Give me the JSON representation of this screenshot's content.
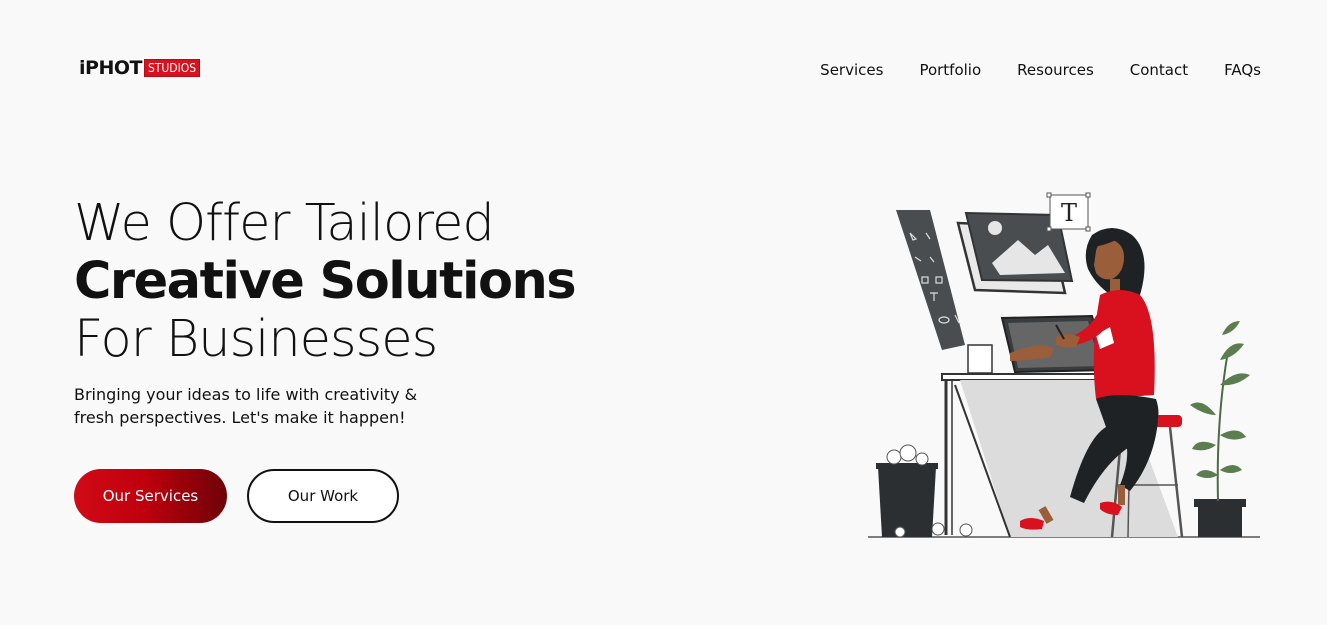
{
  "brand": {
    "name": "iPHOT",
    "tag": "STUDIOS",
    "accent": "#d9101e"
  },
  "nav": {
    "items": [
      {
        "label": "Services"
      },
      {
        "label": "Portfolio"
      },
      {
        "label": "Resources"
      },
      {
        "label": "Contact"
      },
      {
        "label": "FAQs"
      }
    ]
  },
  "hero": {
    "line1": "We Offer Tailored",
    "line2": "Creative Solutions",
    "line3": "For Businesses",
    "subtitle": "Bringing your ideas to life with creativity & fresh perspectives. Let's make it happen!",
    "primary_button": "Our Services",
    "secondary_button": "Our Work"
  },
  "illustration": {
    "icon": "designer-at-desk-illustration",
    "text_tool_glyph": "T"
  }
}
